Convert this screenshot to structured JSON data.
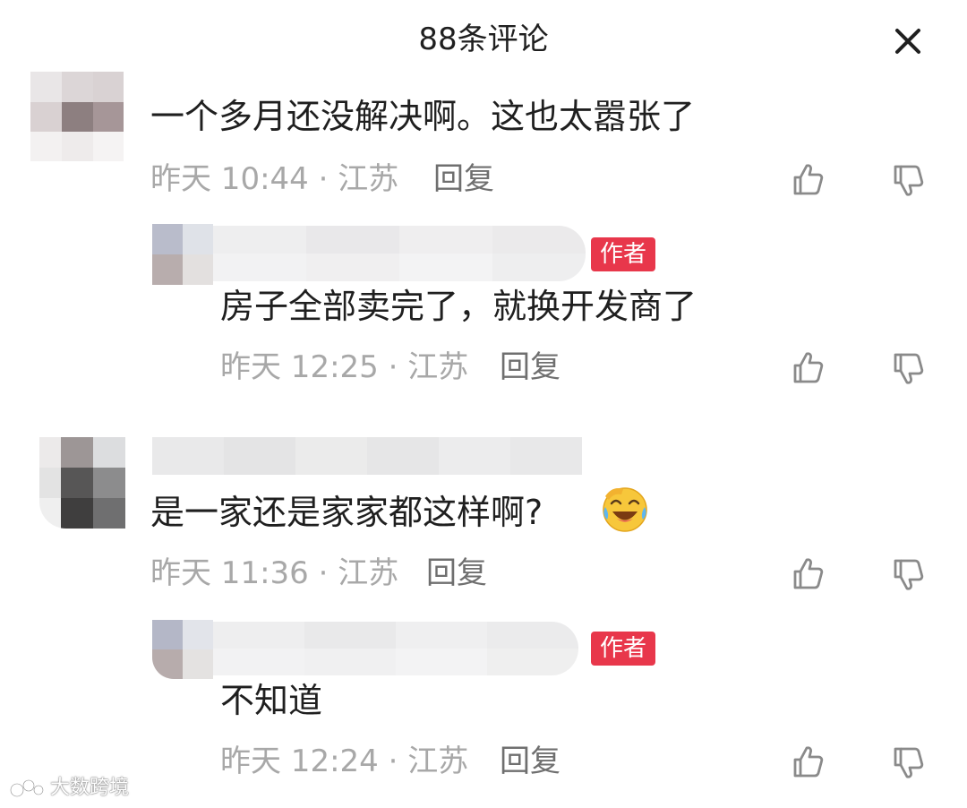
{
  "header": {
    "title": "88条评论",
    "close_icon": "close-icon"
  },
  "comments": [
    {
      "text": "一个多月还没解决啊。这也太嚣张了",
      "meta": "昨天 10:44 · 江苏",
      "reply_label": "回复",
      "replies": [
        {
          "badge": "作者",
          "text": "房子全部卖完了，就换开发商了",
          "meta": "昨天 12:25 · 江苏",
          "reply_label": "回复"
        }
      ]
    },
    {
      "text": "是一家还是家家都这样啊?",
      "emoji": "laughing-crying-emoji",
      "meta": "昨天 11:36 · 江苏",
      "reply_label": "回复",
      "replies": [
        {
          "badge": "作者",
          "text": "不知道",
          "meta": "昨天 12:24 · 江苏",
          "reply_label": "回复"
        }
      ]
    }
  ],
  "icons": {
    "like": "thumbs-up-icon",
    "dislike": "thumbs-down-icon"
  },
  "colors": {
    "badge": "#e8374b",
    "text": "#1f1f1f",
    "meta": "#a8a8a8"
  },
  "watermark": {
    "text": "大数跨境"
  }
}
